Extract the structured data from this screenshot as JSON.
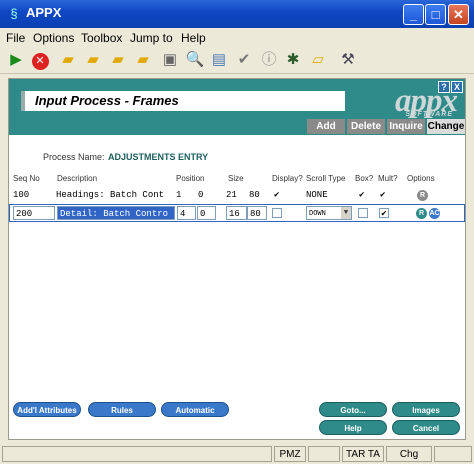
{
  "window": {
    "title": "APPX"
  },
  "menu": [
    "File",
    "Options",
    "Toolbox",
    "Jump to",
    "Help"
  ],
  "toolbar": [
    "play-icon",
    "stop-icon",
    "folder-icon",
    "folder-icon",
    "folder-icon",
    "folder-icon",
    "tv-icon",
    "search-icon",
    "preview-icon",
    "check-icon",
    "info-icon",
    "bug-icon",
    "folder-open-icon",
    "tools-icon"
  ],
  "banner": {
    "help": [
      "?",
      "X"
    ],
    "title": "Input Process - Frames",
    "logo": "appx",
    "logo_sub": "SOFTWARE",
    "tabs": [
      "Add",
      "Delete",
      "Inquire",
      "Change"
    ],
    "active_tab": "Change"
  },
  "process": {
    "label": "Process Name:",
    "value": "ADJUSTMENTS ENTRY"
  },
  "columns": [
    "Seq No",
    "Description",
    "Position",
    "Size",
    "Display?",
    "Scroll Type",
    "Box?",
    "Mult?",
    "Options"
  ],
  "rows": [
    {
      "seq": "100",
      "desc": "Headings: Batch Cont",
      "pos1": "1",
      "pos2": "0",
      "size1": "21",
      "size2": "80",
      "display": "✔",
      "scroll": "NONE",
      "box": "✔",
      "mult": "✔",
      "options": [
        "R"
      ]
    },
    {
      "seq": "200",
      "desc": "Detail: Batch Contro",
      "pos1": "4",
      "pos2": "0",
      "size1": "16",
      "size2": "80",
      "display": "",
      "scroll": "DOWN",
      "box": "",
      "mult": "✔",
      "options": [
        "R",
        "AC"
      ]
    }
  ],
  "buttons": {
    "addl": "Add'l Attributes",
    "rules": "Rules",
    "auto": "Automatic Children",
    "goto": "Goto...",
    "images": "Images",
    "help": "Help",
    "cancel": "Cancel"
  },
  "status": [
    "PMZ",
    "TAR TA",
    "Chg"
  ],
  "colors": {
    "teal": "#2f8a8a",
    "button_blue": "#3a78c9",
    "title_blue": "#0f48c4"
  }
}
